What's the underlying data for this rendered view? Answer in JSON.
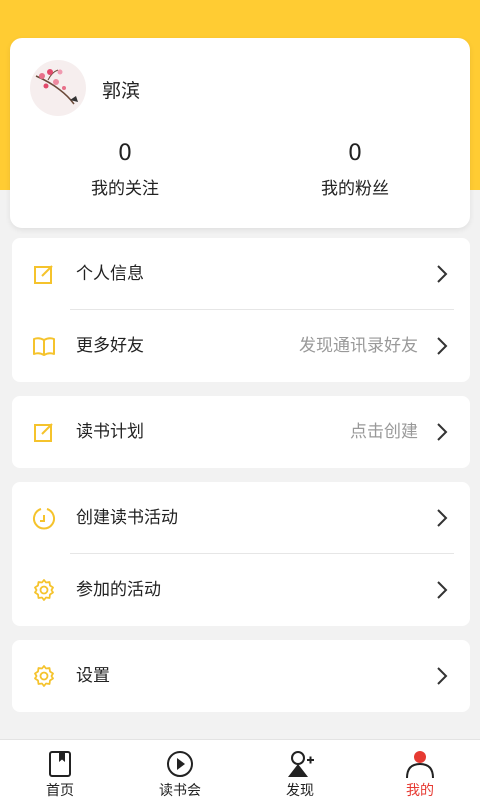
{
  "profile": {
    "username": "郭滨",
    "following_count": "0",
    "following_label": "我的关注",
    "followers_count": "0",
    "followers_label": "我的粉丝"
  },
  "menu": {
    "personal_info": "个人信息",
    "more_friends": "更多好友",
    "more_friends_hint": "发现通讯录好友",
    "reading_plan": "读书计划",
    "reading_plan_hint": "点击创建",
    "create_activity": "创建读书活动",
    "joined_activities": "参加的活动",
    "settings": "设置"
  },
  "tabs": [
    {
      "label": "首页",
      "icon": "book-icon"
    },
    {
      "label": "读书会",
      "icon": "play-icon"
    },
    {
      "label": "发现",
      "icon": "add-contact-icon"
    },
    {
      "label": "我的",
      "icon": "person-icon"
    }
  ],
  "colors": {
    "accent_yellow": "#ffcc33",
    "icon_yellow": "#f5c32c",
    "active_tab": "#e63a32"
  }
}
